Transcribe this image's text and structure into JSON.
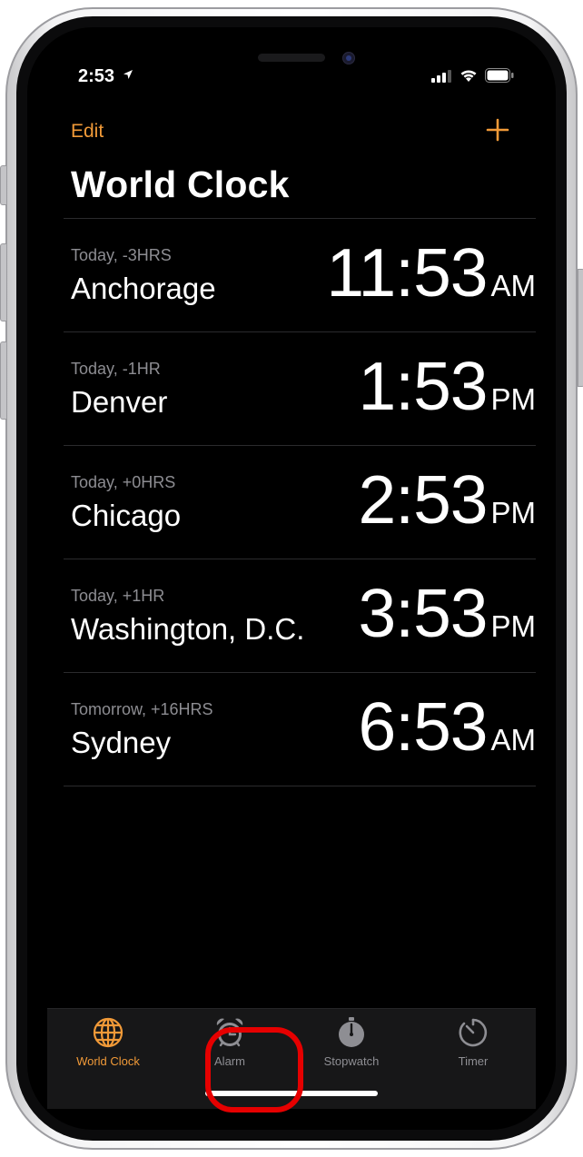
{
  "status_bar": {
    "time": "2:53"
  },
  "nav": {
    "edit_label": "Edit"
  },
  "page": {
    "title": "World Clock"
  },
  "clocks": [
    {
      "offset": "Today, -3HRS",
      "city": "Anchorage",
      "time": "11:53",
      "ampm": "AM"
    },
    {
      "offset": "Today, -1HR",
      "city": "Denver",
      "time": "1:53",
      "ampm": "PM"
    },
    {
      "offset": "Today, +0HRS",
      "city": "Chicago",
      "time": "2:53",
      "ampm": "PM"
    },
    {
      "offset": "Today, +1HR",
      "city": "Washington, D.C.",
      "time": "3:53",
      "ampm": "PM"
    },
    {
      "offset": "Tomorrow, +16HRS",
      "city": "Sydney",
      "time": "6:53",
      "ampm": "AM"
    }
  ],
  "tabs": [
    {
      "label": "World Clock",
      "icon": "globe-icon",
      "active": true
    },
    {
      "label": "Alarm",
      "icon": "alarm-clock-icon",
      "active": false
    },
    {
      "label": "Stopwatch",
      "icon": "stopwatch-icon",
      "active": false
    },
    {
      "label": "Timer",
      "icon": "timer-icon",
      "active": false
    }
  ],
  "colors": {
    "accent": "#f19a38",
    "background": "#000000",
    "annotation_ring": "#e60000"
  }
}
